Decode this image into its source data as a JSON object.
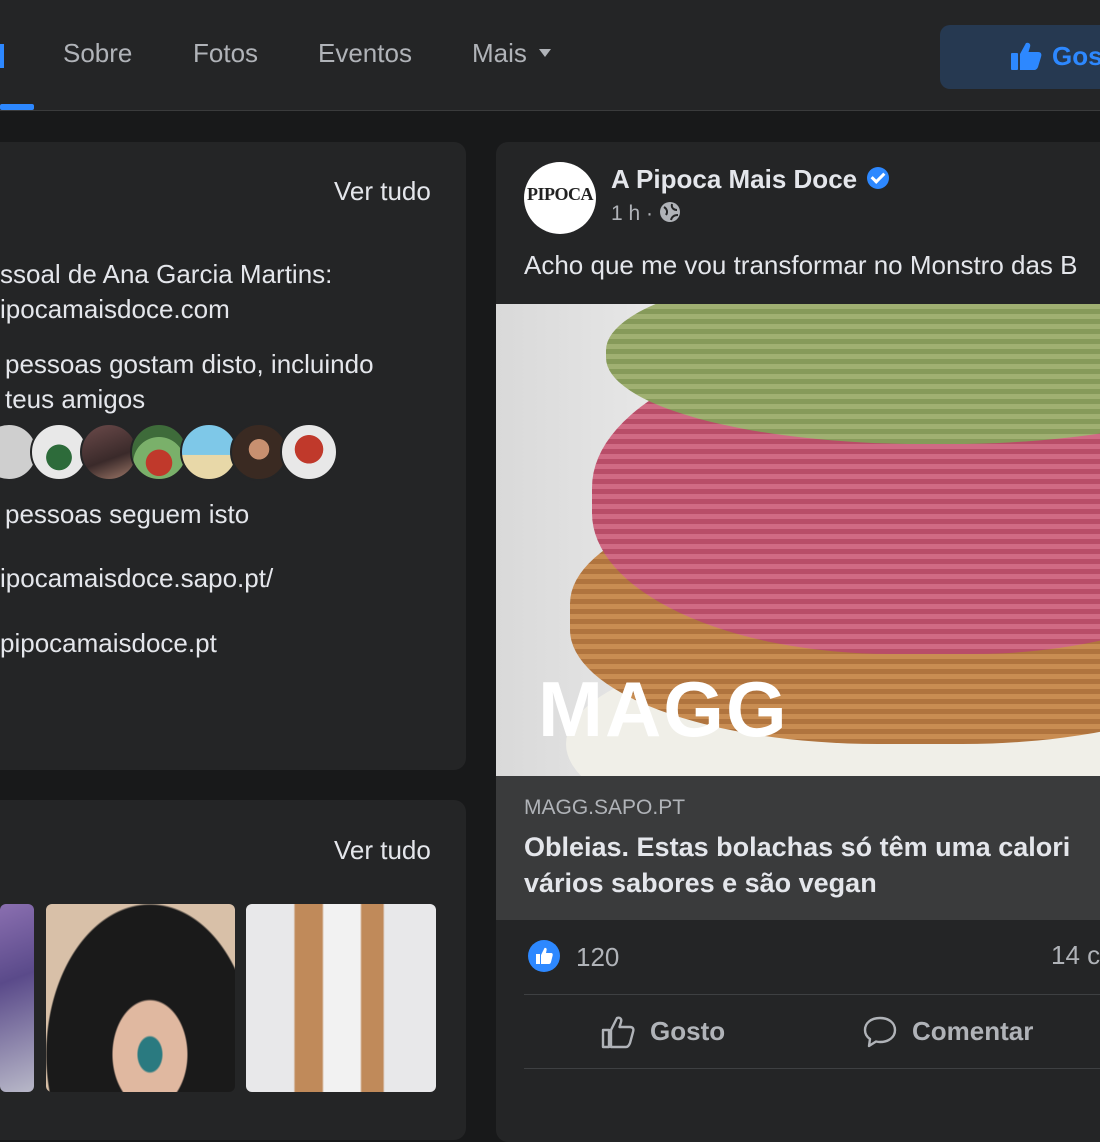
{
  "tabs": {
    "items": [
      "Sobre",
      "Fotos",
      "Eventos",
      "Mais"
    ]
  },
  "page_actions": {
    "like_label": "Gos"
  },
  "about_card": {
    "see_all": "Ver tudo",
    "line1": "ssoal de Ana Garcia Martins:",
    "line2": "ipocamaisdoce.com",
    "likes_line1": "pessoas gostam disto, incluindo",
    "likes_line2": "teus amigos",
    "follow_line": "pessoas seguem isto",
    "website": "ipocamaisdoce.sapo.pt/",
    "email": "pipocamaisdoce.pt"
  },
  "photos_card": {
    "see_all": "Ver tudo"
  },
  "post": {
    "page_name": "A Pipoca Mais Doce",
    "profile_logo_text": "PIPOCA",
    "time": "1 h ·",
    "text": "Acho que me vou transformar no Monstro das B",
    "image_watermark": "MAGG",
    "link_domain": "MAGG.SAPO.PT",
    "link_title_1": "Obleias. Estas bolachas só têm uma calori",
    "link_title_2": "vários sabores e são vegan",
    "reactions_count": "120",
    "comments_count": "14 c",
    "like_action": "Gosto",
    "comment_action": "Comentar"
  },
  "colors": {
    "accent": "#2d88ff",
    "background": "#18191a",
    "card": "#242526"
  },
  "icons": [
    "thumbs-up-icon",
    "globe-icon",
    "verified-badge-icon",
    "comment-icon",
    "caret-down-icon"
  ]
}
